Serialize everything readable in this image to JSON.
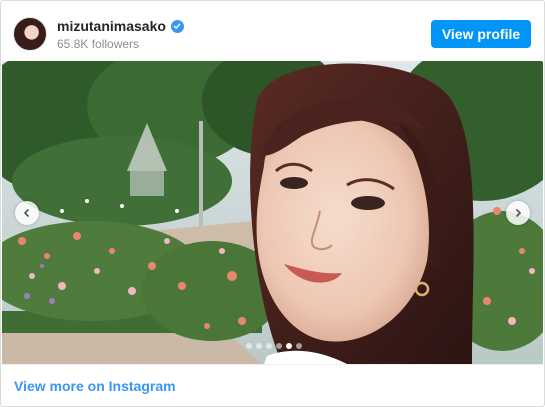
{
  "header": {
    "username": "mizutanimasako",
    "followers": "65.8K followers",
    "view_profile_label": "View profile"
  },
  "post": {
    "carousel_dots": 6,
    "active_dot": 4
  },
  "footer": {
    "view_more_label": "View more on Instagram"
  },
  "colors": {
    "accent": "#0095f6",
    "link": "#3897f0",
    "border": "#dbdbdb"
  },
  "icons": {
    "verified": "verified-badge-icon",
    "prev": "chevron-left-icon",
    "next": "chevron-right-icon"
  }
}
